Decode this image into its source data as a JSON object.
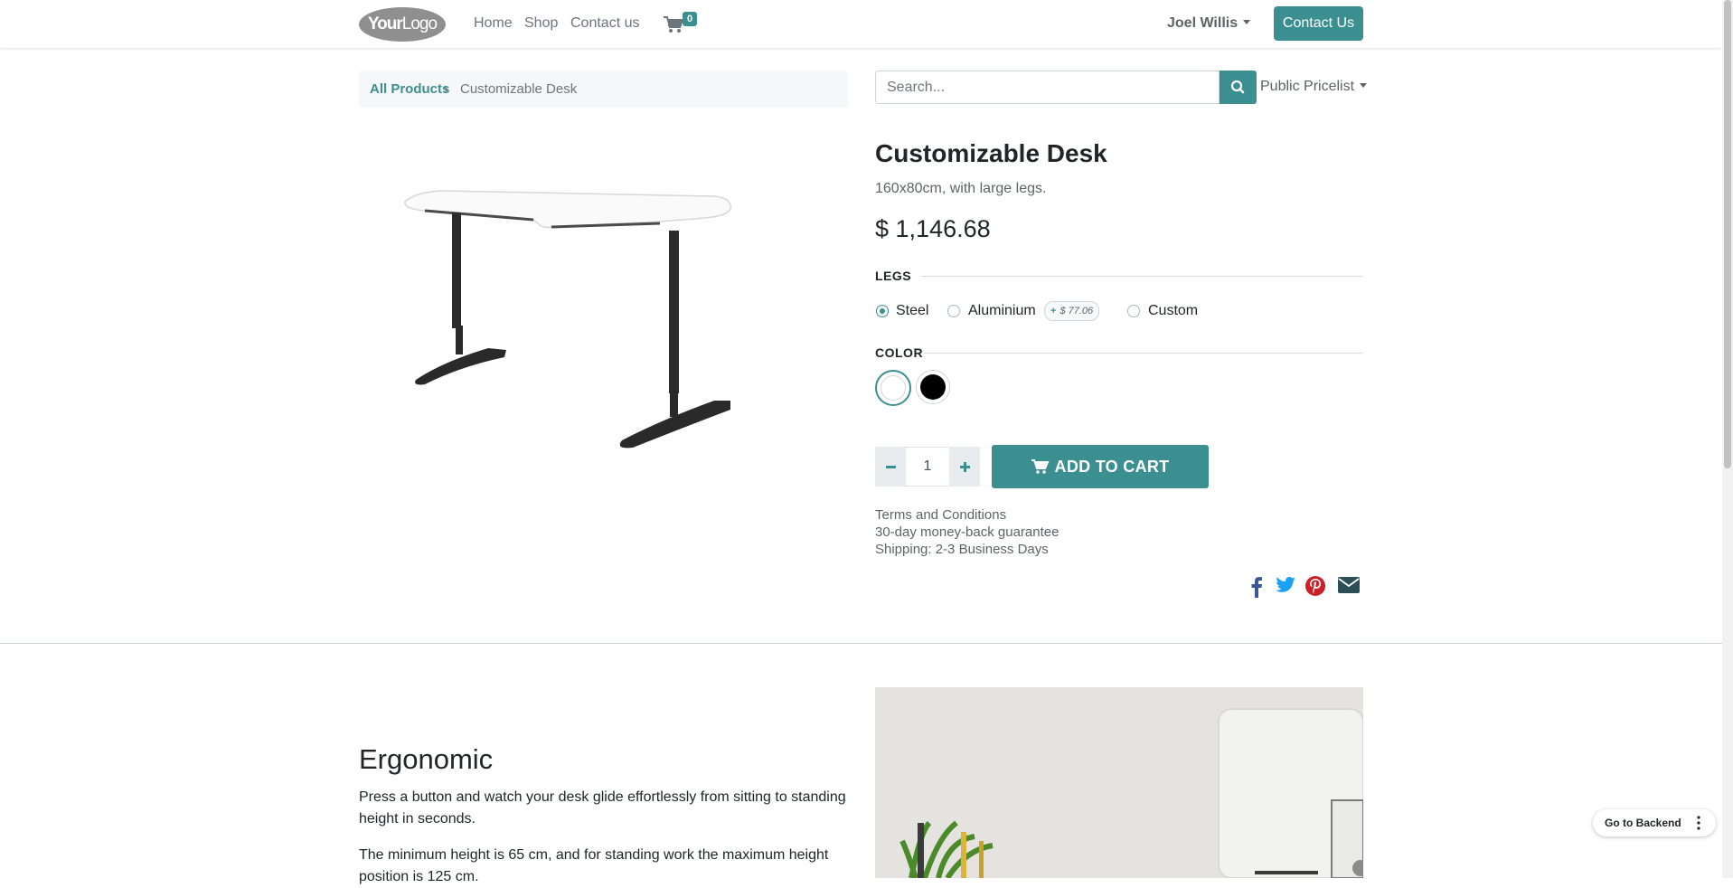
{
  "header": {
    "logo": {
      "your": "Your",
      "logo": "Logo"
    },
    "nav": [
      "Home",
      "Shop",
      "Contact us"
    ],
    "cart_count": "0",
    "user_name": "Joel Willis",
    "contact_button": "Contact Us"
  },
  "breadcrumb": {
    "parent": "All Products",
    "separator": "›",
    "current": "Customizable Desk"
  },
  "search": {
    "placeholder": "Search..."
  },
  "pricelist": "Public Pricelist",
  "product": {
    "name": "Customizable Desk",
    "description": "160x80cm, with large legs.",
    "price": "$ 1,146.68",
    "legs_label": "LEGS",
    "legs_options": [
      {
        "label": "Steel",
        "selected": true
      },
      {
        "label": "Aluminium",
        "extra": "$ 77.06",
        "extra_prefix": "+"
      },
      {
        "label": "Custom"
      }
    ],
    "color_label": "COLOR",
    "colors": [
      {
        "name": "White",
        "hex": "#ffffff",
        "selected": true
      },
      {
        "name": "Black",
        "hex": "#000000"
      }
    ],
    "quantity": "1",
    "add_to_cart": "ADD TO CART"
  },
  "info": [
    "Terms and Conditions",
    "30-day money-back guarantee",
    "Shipping: 2-3 Business Days"
  ],
  "share_icons": [
    "facebook-icon",
    "twitter-icon",
    "pinterest-icon",
    "email-icon"
  ],
  "content": {
    "heading": "Ergonomic",
    "paragraphs": [
      "Press a button and watch your desk glide effortlessly from sitting to standing height in seconds.",
      "The minimum height is 65 cm, and for standing work the maximum height position is 125 cm."
    ]
  },
  "backend_button": "Go to Backend",
  "colors": {
    "accent": "#3b8f91",
    "facebook": "#3b5998",
    "twitter": "#1da1f2",
    "pinterest": "#cb2027",
    "email": "#2c4f56"
  }
}
